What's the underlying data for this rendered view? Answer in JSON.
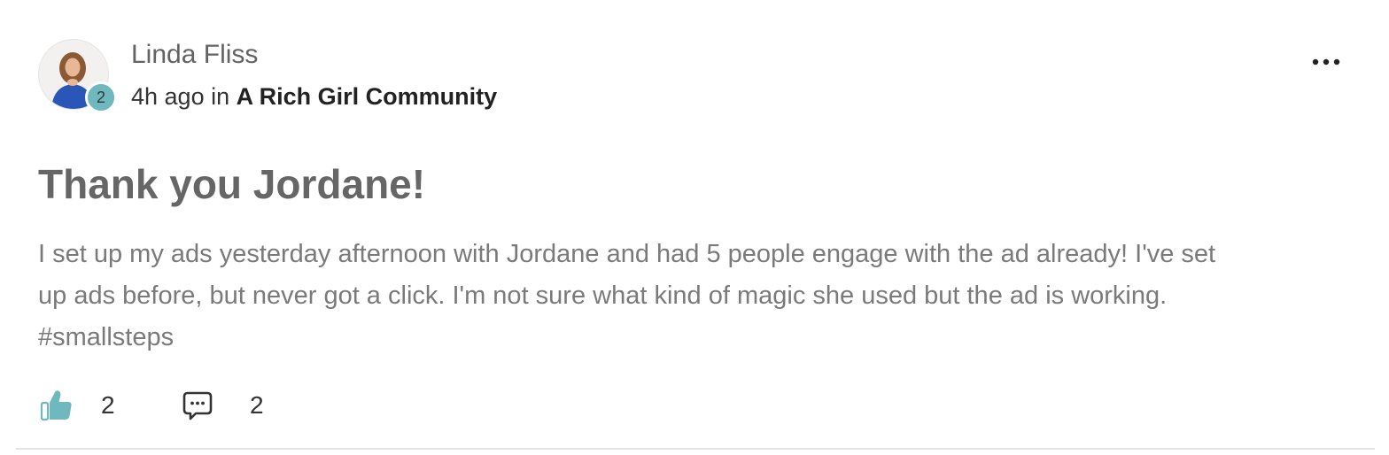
{
  "post": {
    "author": {
      "name": "Linda Fliss",
      "level": "2"
    },
    "time_ago": "4h ago",
    "in_label": "in",
    "group_name": "A Rich Girl Community",
    "title": "Thank you Jordane!",
    "body_lines": [
      "I set up my ads yesterday afternoon with Jordane and had 5 people engage with the ad already! I've set",
      "up ads before, but never got a click.  I'm not sure what kind of magic she used but the ad is working.",
      "#smallsteps"
    ],
    "likes": "2",
    "comments": "2"
  },
  "icons": {
    "more": "more-horizontal-icon",
    "like": "thumbs-up-icon",
    "comment": "comment-bubble-icon"
  },
  "colors": {
    "accent": "#6fb8bd",
    "title": "#666666",
    "body": "#7a7a7a"
  }
}
